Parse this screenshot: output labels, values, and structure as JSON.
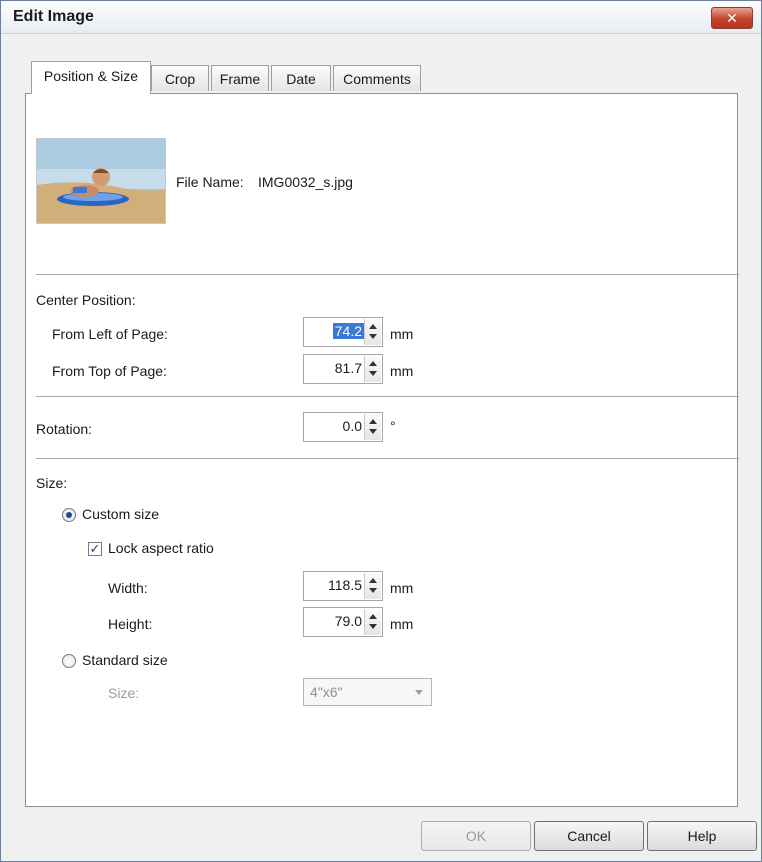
{
  "window": {
    "title": "Edit Image",
    "close_glyph": "✕"
  },
  "tabs": [
    {
      "label": "Position & Size",
      "active": true
    },
    {
      "label": "Crop"
    },
    {
      "label": "Frame"
    },
    {
      "label": "Date"
    },
    {
      "label": "Comments"
    }
  ],
  "file": {
    "label": "File Name:",
    "name": "IMG0032_s.jpg"
  },
  "center_position": {
    "heading": "Center Position:",
    "from_left": {
      "label": "From Left of Page:",
      "value": "74.2",
      "unit": "mm"
    },
    "from_top": {
      "label": "From Top of Page:",
      "value": "81.7",
      "unit": "mm"
    }
  },
  "rotation": {
    "label": "Rotation:",
    "value": "0.0",
    "unit": "°"
  },
  "size": {
    "heading": "Size:",
    "custom_size_label": "Custom size",
    "lock_aspect_label": "Lock aspect ratio",
    "lock_checked": true,
    "width": {
      "label": "Width:",
      "value": "118.5",
      "unit": "mm"
    },
    "height": {
      "label": "Height:",
      "value": "79.0",
      "unit": "mm"
    },
    "standard_size_label": "Standard size",
    "standard_size_field_label": "Size:",
    "standard_size_value": "4\"x6\""
  },
  "buttons": {
    "ok": "OK",
    "cancel": "Cancel",
    "help": "Help"
  },
  "icons": {
    "close": "close-icon",
    "spin": "spinner-arrows-icon",
    "dropdown": "chevron-down-icon"
  }
}
